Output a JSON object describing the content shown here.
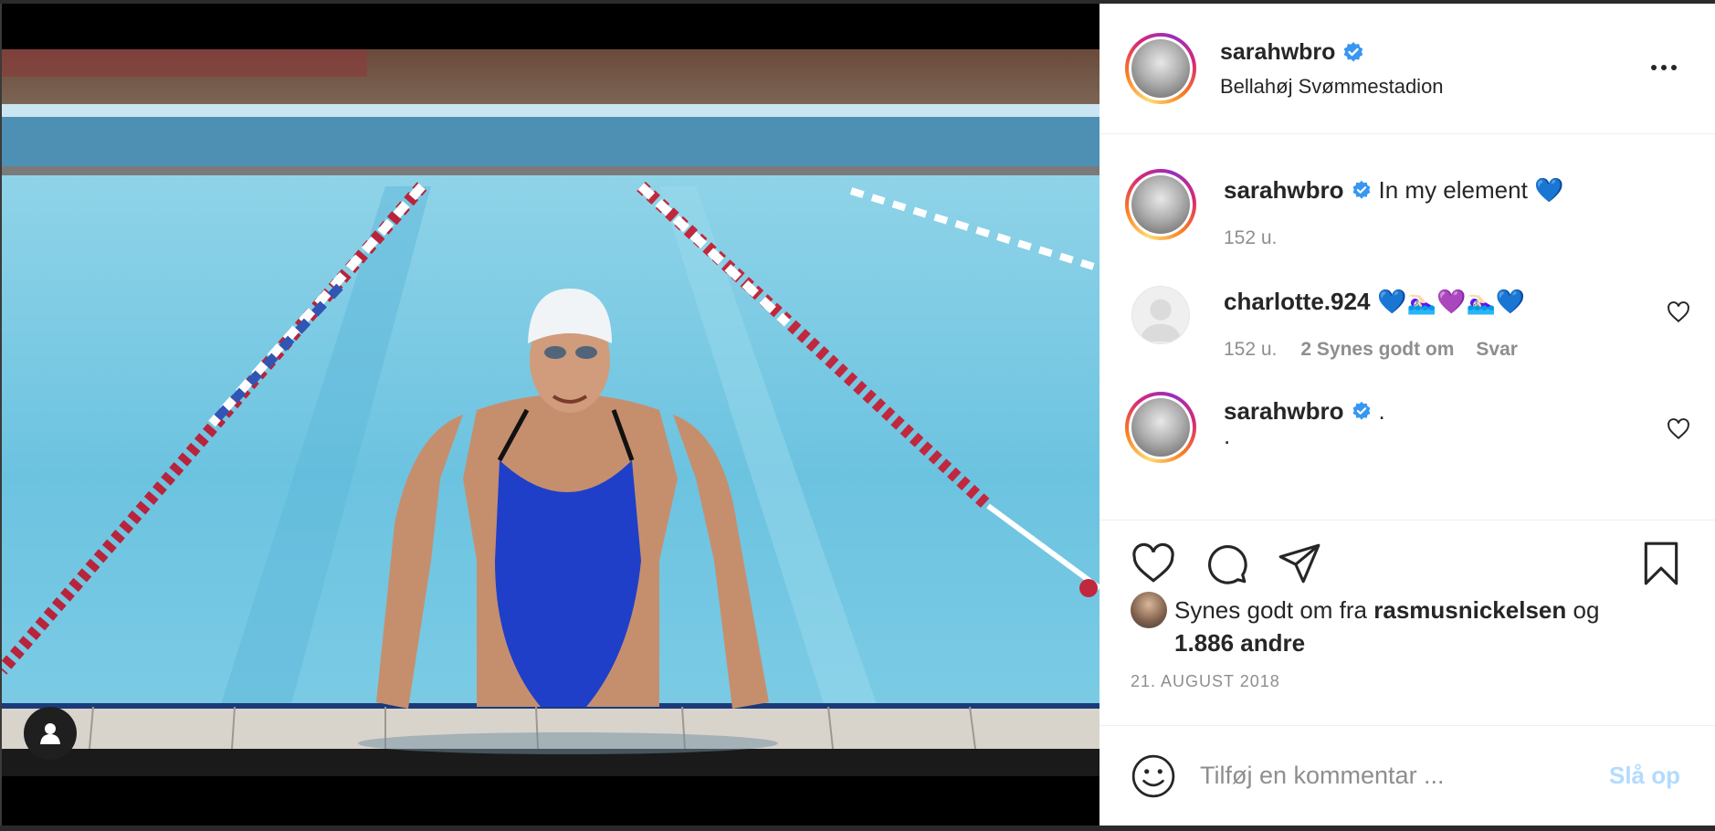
{
  "post": {
    "username": "sarahwbro",
    "verified_icon": "verified-badge-icon",
    "location": "Bellahøj Svømmestadion",
    "more_icon": "more-horizontal-icon"
  },
  "comments": [
    {
      "username": "sarahwbro",
      "text": "In my element 💙",
      "time": "152 u.",
      "avatar": "profile-photo"
    },
    {
      "username": "charlotte.924",
      "text": "💙🏊🏻‍♀️💜🏊🏻‍♀️💙",
      "time": "152 u.",
      "likes": "2 Synes godt om",
      "reply": "Svar",
      "avatar": "default-avatar"
    },
    {
      "username": "sarahwbro",
      "text": ".",
      "text_line2": ".",
      "avatar": "profile-photo"
    }
  ],
  "likes": {
    "prefix": "Synes godt om fra",
    "user": "rasmusnickelsen",
    "connector": "og",
    "others": "1.886 andre"
  },
  "date": "21. AUGUST 2018",
  "add_comment": {
    "placeholder": "Tilføj en kommentar ...",
    "post_label": "Slå op"
  },
  "colors": {
    "accent": "#0095f6",
    "post_disabled": "#b3dbff",
    "muted": "#8e8e8e",
    "verified": "#3897f0"
  }
}
